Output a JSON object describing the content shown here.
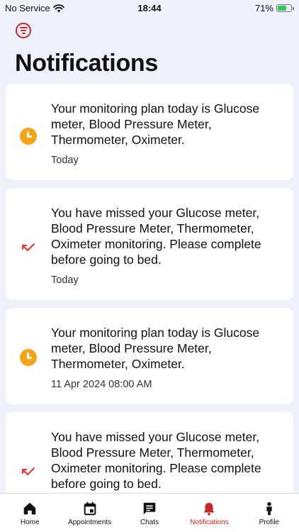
{
  "status_bar": {
    "carrier": "No Service",
    "time": "18:44",
    "battery": "71%",
    "battery_level": 0.71
  },
  "header": {
    "title": "Notifications"
  },
  "notifications": [
    {
      "type": "plan",
      "icon": "clock-icon",
      "message": "Your monitoring plan today is Glucose meter, Blood Pressure Meter, Thermometer, Oximeter.",
      "time": "Today"
    },
    {
      "type": "missed",
      "icon": "missed-call-icon",
      "message": "You have missed your Glucose meter, Blood Pressure Meter, Thermometer, Oximeter monitoring. Please complete before going to bed.",
      "time": "Today"
    },
    {
      "type": "plan",
      "icon": "clock-icon",
      "message": "Your monitoring plan today is Glucose meter, Blood Pressure Meter, Thermometer, Oximeter.",
      "time": "11 Apr 2024 08:00 AM"
    },
    {
      "type": "missed",
      "icon": "missed-call-icon",
      "message": "You have missed your Glucose meter, Blood Pressure Meter, Thermometer, Oximeter monitoring. Please complete before going to bed.",
      "time": ""
    }
  ],
  "tabs": [
    {
      "label": "Home",
      "icon": "home-icon",
      "active": false
    },
    {
      "label": "Appointments",
      "icon": "calendar-icon",
      "active": false
    },
    {
      "label": "Chats",
      "icon": "chat-icon",
      "active": false
    },
    {
      "label": "Notifications",
      "icon": "bell-icon",
      "active": true
    },
    {
      "label": "Profile",
      "icon": "person-icon",
      "active": false
    }
  ],
  "colors": {
    "accent": "#c62828",
    "clock": "#f5a31a",
    "missed": "#e53935",
    "background": "#eef1fa"
  }
}
